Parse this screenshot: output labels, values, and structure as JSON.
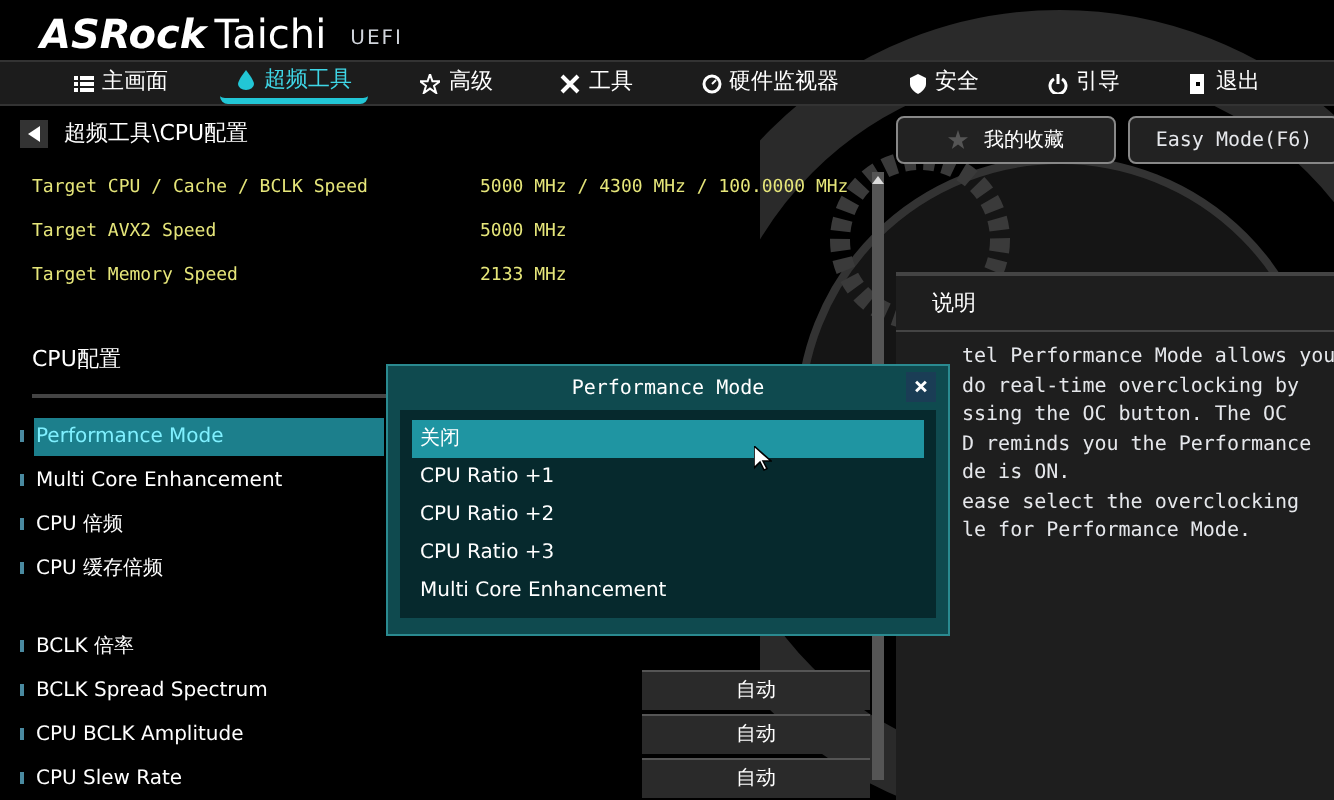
{
  "logo": {
    "brand": "ASRock",
    "product": "Taichi",
    "suffix": "UEFI"
  },
  "nav": [
    {
      "label": "主画面",
      "selected": false
    },
    {
      "label": "超频工具",
      "selected": true
    },
    {
      "label": "高级",
      "selected": false
    },
    {
      "label": "工具",
      "selected": false
    },
    {
      "label": "硬件监视器",
      "selected": false
    },
    {
      "label": "安全",
      "selected": false
    },
    {
      "label": "引导",
      "selected": false
    },
    {
      "label": "退出",
      "selected": false
    }
  ],
  "breadcrumb": "超频工具\\CPU配置",
  "favorites_button": "我的收藏",
  "easy_mode_button": "Easy Mode(F6)",
  "info": [
    {
      "label": "Target CPU / Cache / BCLK Speed",
      "value": "5000 MHz / 4300 MHz / 100.0000 MHz"
    },
    {
      "label": "Target AVX2 Speed",
      "value": "5000 MHz"
    },
    {
      "label": "Target Memory Speed",
      "value": "2133 MHz"
    }
  ],
  "section_title": "CPU配置",
  "setting_groups": [
    [
      {
        "label": "Performance Mode",
        "selected": true
      },
      {
        "label": "Multi Core Enhancement",
        "selected": false
      },
      {
        "label": "CPU 倍频",
        "selected": false
      },
      {
        "label": "CPU 缓存倍频",
        "selected": false
      }
    ],
    [
      {
        "label": "BCLK 倍率",
        "selected": false
      },
      {
        "label": "BCLK Spread Spectrum",
        "selected": false,
        "value": "自动"
      },
      {
        "label": "CPU BCLK Amplitude",
        "selected": false,
        "value": "自动"
      },
      {
        "label": "CPU Slew Rate",
        "selected": false,
        "value": "自动"
      }
    ]
  ],
  "description": {
    "title": "说明",
    "lines": [
      "tel Performance Mode allows you",
      "do real-time overclocking by",
      "ssing the OC button. The OC",
      "D reminds you the Performance",
      "de is ON.",
      "ease select the overclocking",
      "le for Performance Mode."
    ]
  },
  "popup": {
    "title": "Performance Mode",
    "close": "×",
    "options": [
      {
        "label": "关闭",
        "selected": true
      },
      {
        "label": "CPU Ratio +1",
        "selected": false
      },
      {
        "label": "CPU Ratio +2",
        "selected": false
      },
      {
        "label": "CPU Ratio +3",
        "selected": false
      },
      {
        "label": "Multi Core Enhancement",
        "selected": false
      }
    ]
  }
}
